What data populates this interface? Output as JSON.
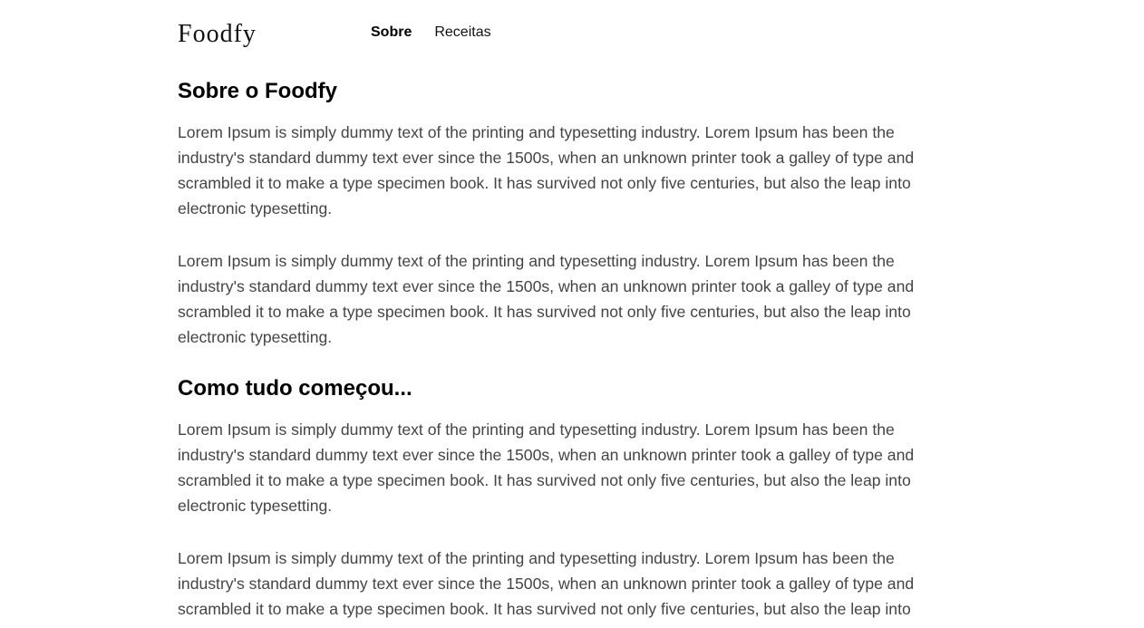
{
  "header": {
    "logo": "Foodfy",
    "nav": [
      {
        "label": "Sobre",
        "active": true
      },
      {
        "label": "Receitas",
        "active": false
      }
    ]
  },
  "sections": [
    {
      "title": "Sobre o Foodfy",
      "paragraphs": [
        "Lorem Ipsum is simply dummy text of the printing and typesetting industry. Lorem Ipsum has been the industry's standard dummy text ever since the 1500s, when an unknown printer took a galley of type and scrambled it to make a type specimen book. It has survived not only five centuries, but also the leap into electronic typesetting.",
        "Lorem Ipsum is simply dummy text of the printing and typesetting industry. Lorem Ipsum has been the industry's standard dummy text ever since the 1500s, when an unknown printer took a galley of type and scrambled it to make a type specimen book. It has survived not only five centuries, but also the leap into electronic typesetting."
      ]
    },
    {
      "title": "Como tudo começou...",
      "paragraphs": [
        "Lorem Ipsum is simply dummy text of the printing and typesetting industry. Lorem Ipsum has been the industry's standard dummy text ever since the 1500s, when an unknown printer took a galley of type and scrambled it to make a type specimen book. It has survived not only five centuries, but also the leap into electronic typesetting.",
        "Lorem Ipsum is simply dummy text of the printing and typesetting industry. Lorem Ipsum has been the industry's standard dummy text ever since the 1500s, when an unknown printer took a galley of type and scrambled it to make a type specimen book. It has survived not only five centuries, but also the leap into electronic typesetting."
      ]
    }
  ]
}
